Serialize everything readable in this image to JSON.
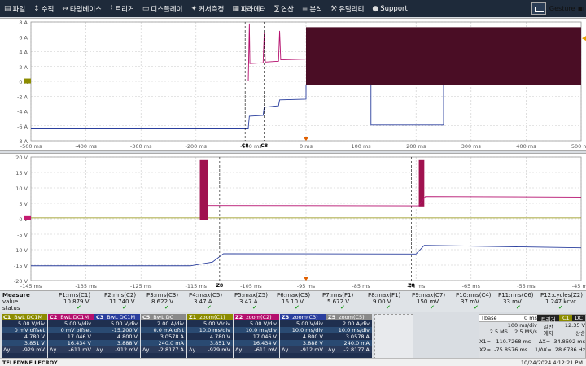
{
  "menu": {
    "items": [
      {
        "label": "파일",
        "icon": "file-icon"
      },
      {
        "label": "수직",
        "icon": "vertical-icon"
      },
      {
        "label": "타임베이스",
        "icon": "timebase-icon"
      },
      {
        "label": "트리거",
        "icon": "trigger-icon"
      },
      {
        "label": "디스플레이",
        "icon": "display-icon"
      },
      {
        "label": "커서측정",
        "icon": "cursor-icon"
      },
      {
        "label": "파라메터",
        "icon": "params-icon"
      },
      {
        "label": "연산",
        "icon": "math-icon"
      },
      {
        "label": "분석",
        "icon": "analysis-icon"
      },
      {
        "label": "유틸리티",
        "icon": "utility-icon"
      },
      {
        "label": "Support",
        "icon": "support-icon"
      }
    ],
    "gesture": "Gesture"
  },
  "top_grid": {
    "y_labels": [
      "8 A",
      "6 A",
      "4 A",
      "2 A",
      "0 A",
      "-2 A",
      "-4 A",
      "-6 A",
      "-8 A"
    ],
    "x_labels": [
      "-500 ms",
      "-400 ms",
      "-300 ms",
      "-200 ms",
      "-100 ms",
      "0 ms",
      "100 ms",
      "200 ms",
      "300 ms",
      "400 ms",
      "500 ms"
    ],
    "cursor_labels": [
      "C8",
      "C8"
    ]
  },
  "bottom_grid": {
    "y_labels": [
      "20 V",
      "15 V",
      "10 V",
      "5 V",
      "0 V",
      "-5 V",
      "-10 V",
      "-15 V",
      "-20 V"
    ],
    "x_labels": [
      "-145 ms",
      "-135 ms",
      "-125 ms",
      "-115 ms",
      "-105 ms",
      "-95 ms",
      "-85 ms",
      "-75 ms",
      "-65 ms",
      "-55 ms",
      "-45 ms"
    ],
    "cursor_labels": [
      "Z8",
      "Z8"
    ]
  },
  "measure": {
    "row_labels": [
      "Measure",
      "value",
      "status"
    ],
    "cols": [
      {
        "name": "P1:rms(C1)",
        "value": "10.879 V"
      },
      {
        "name": "P2:rms(C2)",
        "value": "11.740 V"
      },
      {
        "name": "P3:rms(C3)",
        "value": "8.622 V"
      },
      {
        "name": "P4:max(C5)",
        "value": "3.47 A"
      },
      {
        "name": "P5:max(Z5)",
        "value": "3.47 A"
      },
      {
        "name": "P6:max(C3)",
        "value": "16.10 V"
      },
      {
        "name": "P7:rms(F1)",
        "value": "5.672 V"
      },
      {
        "name": "P8:max(F1)",
        "value": "9.00 V"
      },
      {
        "name": "P9:max(C7)",
        "value": "150 mV"
      },
      {
        "name": "P10:rms(C4)",
        "value": "37 mV"
      },
      {
        "name": "P11:rms(C6)",
        "value": "33 mV"
      },
      {
        "name": "P12:cycles(Z2)",
        "value": "1.247 kcvc"
      }
    ]
  },
  "channels": [
    {
      "name": "C1",
      "tag": "BwL DC1M",
      "color": "#8c8c00",
      "rows": [
        "5.00 V/div",
        "0 mV offset",
        "4.780 V",
        "3.851 V",
        "-929 mV"
      ],
      "unit": "Δy"
    },
    {
      "name": "C2",
      "tag": "BwL DC1M",
      "color": "#b5106e",
      "rows": [
        "5.00 V/div",
        "0 mV offset",
        "17.046 V",
        "16.434 V",
        "-611 mV"
      ],
      "unit": "Δy"
    },
    {
      "name": "C3",
      "tag": "BwL DC1M",
      "color": "#2b3f9e",
      "rows": [
        "5.00 V/div",
        "-15.200 V",
        "4.800 V",
        "3.888 V",
        "-912 mV"
      ],
      "unit": "Δy"
    },
    {
      "name": "C5",
      "tag": "BwL DC",
      "color": "#8a8a8a",
      "rows": [
        "2.00 A/div",
        "0.0 mA ofst",
        "3.0578 A",
        "240.0 mA",
        "-2.8177 A"
      ],
      "unit": "Δy"
    },
    {
      "name": "Z1",
      "tag": "zoom(C1)",
      "color": "#8c8c00",
      "rows": [
        "5.00 V/div",
        "10.0 ms/div",
        "4.780 V",
        "3.851 V",
        "-929 mV"
      ],
      "unit": "Δy"
    },
    {
      "name": "Z2",
      "tag": "zoom(C2)",
      "color": "#b5106e",
      "rows": [
        "5.00 V/div",
        "10.0 ms/div",
        "17.046 V",
        "16.434 V",
        "-611 mV"
      ],
      "unit": "Δy"
    },
    {
      "name": "Z3",
      "tag": "zoom(C3)",
      "color": "#2b3f9e",
      "rows": [
        "5.00 V/div",
        "10.0 ms/div",
        "4.800 V",
        "3.888 V",
        "-912 mV"
      ],
      "unit": "Δy"
    },
    {
      "name": "Z5",
      "tag": "zoom(C5)",
      "color": "#8a8a8a",
      "rows": [
        "2.00 A/div",
        "10.0 ms/div",
        "3.0578 A",
        "240.0 mA",
        "-2.8177 A"
      ],
      "unit": "Δy"
    }
  ],
  "timebase": {
    "label": "Tbase",
    "t0": "0 ms",
    "trig_label": "트리거",
    "trig_ch": "C1",
    "trig_cpl": "DC",
    "tdiv": "100 ms/div",
    "mode": "일반",
    "rate_row": "2.5 MS    2.5 MS/s",
    "trig_mode": "에지",
    "trig_slope": "상승",
    "trig_level": "12.35 V",
    "x1": "X1=  -110.7268 ms",
    "dx": "ΔX=  34.8692 ms",
    "x2": "X2=  -75.8576 ms",
    "fdx": "1/ΔX=  28.6786 Hz"
  },
  "status": {
    "brand": "TELEDYNE LECROY",
    "datetime": "10/24/2024 4:12:21 PM"
  },
  "colors": {
    "menu_bg": "#1e2a3a",
    "ch1": "#8c8c00",
    "ch2": "#b5106e",
    "ch3": "#2b3f9e",
    "ch5": "#8a8a8a",
    "burst": "#4a0d25"
  }
}
